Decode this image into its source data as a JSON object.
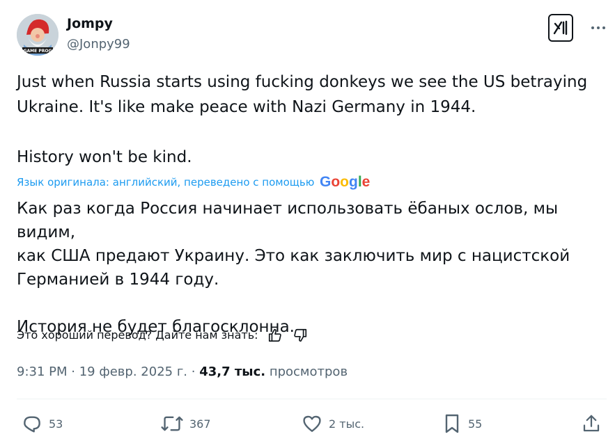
{
  "author": {
    "name": "Jompy",
    "handle": "@Jonpy99",
    "avatar_caption": "GAME PROG"
  },
  "tweet": {
    "original_text": "Just when Russia starts using fucking donkeys we see the US betraying\nUkraine. It's like make peace with Nazi Germany in 1944.\n\nHistory won't be kind.",
    "translation_label": "Язык оригинала: английский, переведено с помощью",
    "translation_provider": "Google",
    "translated_text": "Как раз когда Россия начинает использовать ёбаных ослов, мы видим,\nкак США предают Украину. Это как заключить мир с нацистской\nГерманией в 1944 году.\n\nИстория не будет благосклонна.",
    "rate_prompt": "Это хороший перевод? Дайте нам знать:",
    "time": "9:31 PM",
    "date": "19 февр. 2025 г.",
    "views_count": "43,7 тыс.",
    "views_label": "просмотров"
  },
  "actions": {
    "replies": "53",
    "reposts": "367",
    "likes": "2 тыс.",
    "bookmarks": "55"
  },
  "icons": [
    "grok-icon",
    "more-icon",
    "thumbs-up-icon",
    "thumbs-down-icon",
    "reply-icon",
    "repost-icon",
    "like-icon",
    "bookmark-icon",
    "share-icon"
  ],
  "colors": {
    "text": "#0f1419",
    "secondary": "#536471",
    "link": "#1d9bf0"
  }
}
